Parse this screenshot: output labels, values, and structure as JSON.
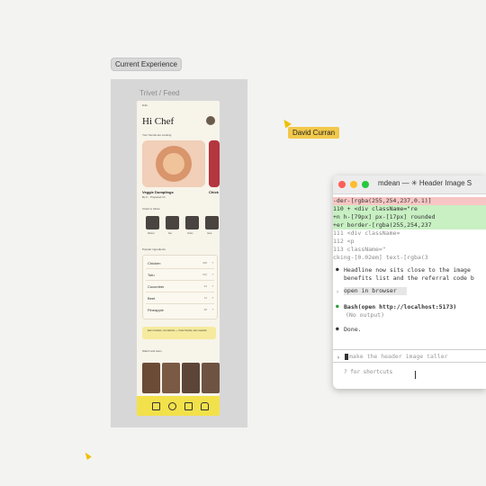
{
  "frame": {
    "tag": "Current Experience",
    "title": "Trivet / Feed"
  },
  "phone": {
    "time": "9:41",
    "greeting": "Hi Chef",
    "friends_label": "Your friends are cooking",
    "recipe_title": "Veggie Dumplings",
    "recipe_author": "By K · Prepared 1h",
    "recipe2_title": "Chick",
    "chefs_label": "Chefs to follow",
    "chefs": [
      "Robert",
      "Kai",
      "Orwin",
      "Gina"
    ],
    "ingredients_label": "Popular ingredients",
    "ingredients": [
      {
        "name": "Chicken",
        "count": "338"
      },
      {
        "name": "Tofu",
        "count": "152"
      },
      {
        "name": "Cucumber",
        "count": "94"
      },
      {
        "name": "Beet",
        "count": "72"
      },
      {
        "name": "Pineapple",
        "count": "38"
      }
    ],
    "promo": "Earn Cookies, not calories — Invite friends, earn rewards",
    "watch_label": "Watch and learn",
    "tabs": [
      "home-icon",
      "search-icon",
      "add-icon",
      "chef-hat-icon"
    ]
  },
  "collab": {
    "name": "David Curran"
  },
  "terminal": {
    "title": "mdean — ✳ Header Image S",
    "lines": [
      {
        "type": "del",
        "text": "  -der-[rgba(255,254,237,0.1)]"
      },
      {
        "type": "add",
        "text": "110 +      <div className=\"re"
      },
      {
        "type": "add",
        "text": "    +n h-[79px] px-[17px] rounded"
      },
      {
        "type": "add",
        "text": "    +er border-[rgba(255,254,237"
      },
      {
        "type": "ctx",
        "text": "111            <div className="
      },
      {
        "type": "ctx",
        "text": "112              <p"
      },
      {
        "type": "ctx",
        "text": "113                className=\""
      },
      {
        "type": "ctx",
        "text": "         cking-[0.02em] text-[rgba(3"
      }
    ],
    "msg1a": "Headline now sits close to the image",
    "msg1b": "benefits list and the referral code b",
    "prompt1": "open in browser",
    "bash": "Bash(open http://localhost:5173)",
    "bash_out": "(No output)",
    "done": "Done.",
    "input_placeholder": "make the header image taller",
    "shortcuts": "? for shortcuts"
  }
}
